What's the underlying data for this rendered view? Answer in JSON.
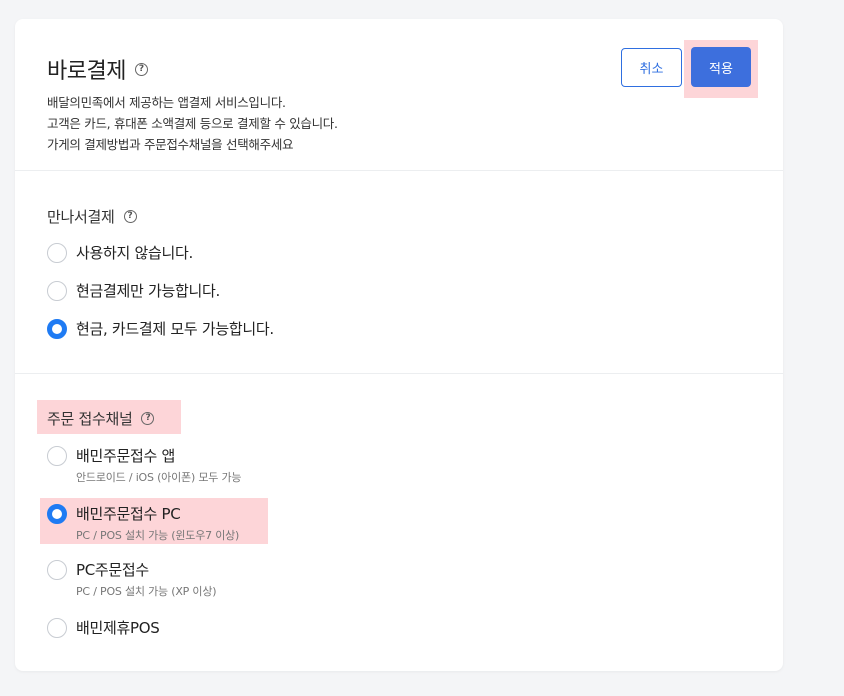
{
  "header": {
    "title": "바로결제",
    "help_icon": "?",
    "description": [
      "배달의민족에서 제공하는 앱결제 서비스입니다.",
      "고객은 카드, 휴대폰 소액결제 등으로 결제할 수 있습니다.",
      "가게의 결제방법과 주문접수채널을 선택해주세요"
    ],
    "cancel_label": "취소",
    "apply_label": "적용"
  },
  "meet_payment": {
    "label": "만나서결제",
    "options": [
      {
        "label": "사용하지 않습니다.",
        "selected": false
      },
      {
        "label": "현금결제만 가능합니다.",
        "selected": false
      },
      {
        "label": "현금, 카드결제 모두 가능합니다.",
        "selected": true
      }
    ]
  },
  "order_channel": {
    "label": "주문 접수채널",
    "options": [
      {
        "label": "배민주문접수 앱",
        "sub": "안드로이드 / iOS (아이폰) 모두 가능",
        "selected": false
      },
      {
        "label": "배민주문접수 PC",
        "sub": "PC / POS 설치 가능 (윈도우7 이상)",
        "selected": true
      },
      {
        "label": "PC주문접수",
        "sub": "PC / POS 설치 가능 (XP 이상)",
        "selected": false
      },
      {
        "label": "배민제휴POS",
        "sub": "",
        "selected": false
      }
    ]
  },
  "colors": {
    "accent": "#3d6fdd",
    "radio_selected": "#1f7bf3",
    "highlight": "#fdd5d8"
  }
}
